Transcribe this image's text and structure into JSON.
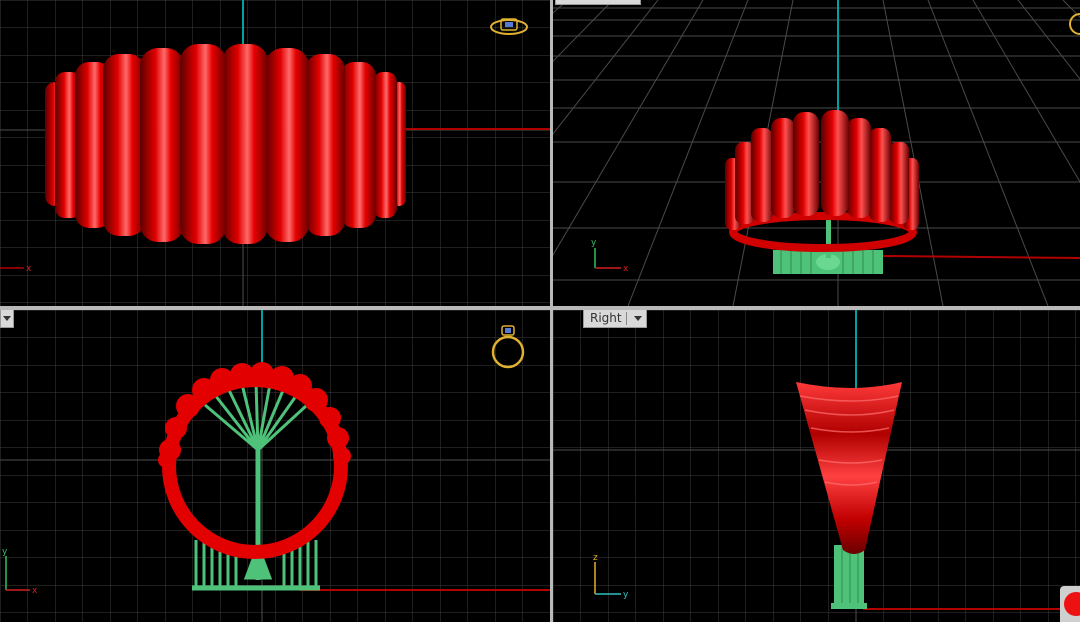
{
  "viewports": {
    "front": {
      "axis_h": "x",
      "icon": "ring-front-icon"
    },
    "perspective": {
      "axis_h": "x",
      "axis_v": "y",
      "icon": "ring-persp-icon"
    },
    "top": {
      "axis_h": "x",
      "axis_v": "y",
      "icon": "ring-top-icon"
    },
    "right": {
      "label": "Right",
      "axis_h": "y",
      "axis_v": "z"
    }
  },
  "colors": {
    "background": "#000000",
    "grid": "#3a3a3a",
    "grid_major": "#595959",
    "ring": "#e30000",
    "support": "#4fc27a",
    "x_axis": "#b00000",
    "z_axis": "#00a0a0",
    "icon": "#e0b030"
  }
}
